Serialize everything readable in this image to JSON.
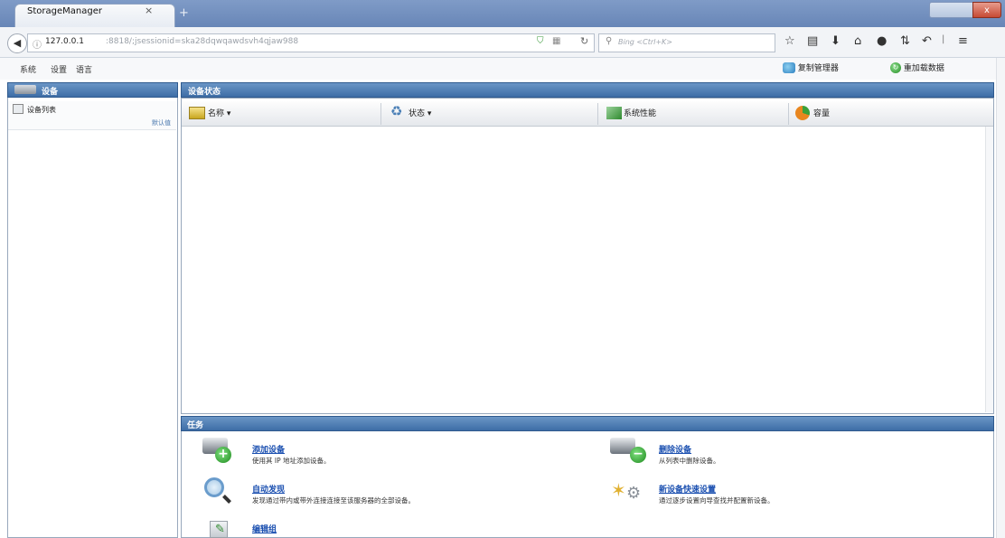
{
  "browser": {
    "tab_title": "StorageManager",
    "tab_close": "×",
    "new_tab": "+",
    "window_close": "x",
    "url_host": "127.0.0.1",
    "url_rest": ":8818/;jsessionid=ska28dqwqawdsvh4qjaw988",
    "search_placeholder": "Bing <Ctrl+K>"
  },
  "menu": {
    "items": [
      "系统",
      "设置",
      "语言"
    ],
    "device_manager": "复制管理器",
    "add_data": "重加载数据"
  },
  "left_panel": {
    "title": "设备",
    "device_list_label": "设备列表",
    "default_label": "默认值"
  },
  "main_panel": {
    "title": "设备状态",
    "columns": [
      "名称 ▾",
      "状态 ▾",
      "系统性能",
      "容量"
    ]
  },
  "tasks": {
    "title": "任务",
    "items": [
      {
        "label": "添加设备",
        "desc": "使用其 IP 地址添加设备。"
      },
      {
        "label": "删除设备",
        "desc": "从列表中删除设备。"
      },
      {
        "label": "自动发现",
        "desc": "发现通过带内或带外连接连接至该服务器的全部设备。"
      },
      {
        "label": "新设备快速设置",
        "desc": "通过逐步设置向导查找并配置新设备。"
      },
      {
        "label": "编辑组",
        "desc": ""
      }
    ]
  }
}
